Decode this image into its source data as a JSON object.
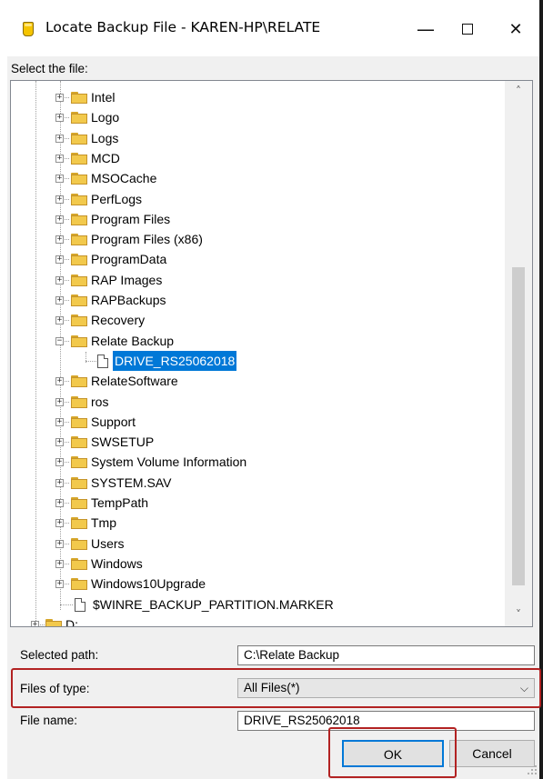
{
  "window": {
    "title": "Locate Backup File - KAREN-HP\\RELATE",
    "minimize_label": "—",
    "close_label": "✕"
  },
  "select_label": "Select the file:",
  "tree": {
    "items": [
      {
        "label": "Intel",
        "type": "folder",
        "expander": "+"
      },
      {
        "label": "Logo",
        "type": "folder",
        "expander": "+"
      },
      {
        "label": "Logs",
        "type": "folder",
        "expander": "+"
      },
      {
        "label": "MCD",
        "type": "folder",
        "expander": "+"
      },
      {
        "label": "MSOCache",
        "type": "folder",
        "expander": "+"
      },
      {
        "label": "PerfLogs",
        "type": "folder",
        "expander": "+"
      },
      {
        "label": "Program Files",
        "type": "folder",
        "expander": "+"
      },
      {
        "label": "Program Files (x86)",
        "type": "folder",
        "expander": "+"
      },
      {
        "label": "ProgramData",
        "type": "folder",
        "expander": "+"
      },
      {
        "label": "RAP Images",
        "type": "folder",
        "expander": "+"
      },
      {
        "label": "RAPBackups",
        "type": "folder",
        "expander": "+"
      },
      {
        "label": "Recovery",
        "type": "folder",
        "expander": "+"
      },
      {
        "label": "Relate Backup",
        "type": "folder",
        "expander": "−"
      },
      {
        "label": "DRIVE_RS25062018",
        "type": "file",
        "selected": true
      },
      {
        "label": "RelateSoftware",
        "type": "folder",
        "expander": "+"
      },
      {
        "label": "ros",
        "type": "folder",
        "expander": "+"
      },
      {
        "label": "Support",
        "type": "folder",
        "expander": "+"
      },
      {
        "label": "SWSETUP",
        "type": "folder",
        "expander": "+"
      },
      {
        "label": "System Volume Information",
        "type": "folder",
        "expander": "+"
      },
      {
        "label": "SYSTEM.SAV",
        "type": "folder",
        "expander": "+"
      },
      {
        "label": "TempPath",
        "type": "folder",
        "expander": "+"
      },
      {
        "label": "Tmp",
        "type": "folder",
        "expander": "+"
      },
      {
        "label": "Users",
        "type": "folder",
        "expander": "+"
      },
      {
        "label": "Windows",
        "type": "folder",
        "expander": "+"
      },
      {
        "label": "Windows10Upgrade",
        "type": "folder",
        "expander": "+"
      },
      {
        "label": "$WINRE_BACKUP_PARTITION.MARKER",
        "type": "rootfile"
      },
      {
        "label": "D:",
        "type": "drive",
        "expander": "+"
      }
    ]
  },
  "scrollbar": {
    "up_icon": "˄",
    "down_icon": "˅"
  },
  "fields": {
    "selected_path_label": "Selected path:",
    "selected_path_value": "C:\\Relate Backup",
    "files_of_type_label": "Files of type:",
    "files_of_type_value": "All Files(*)",
    "file_name_label": "File name:",
    "file_name_value": "DRIVE_RS25062018"
  },
  "buttons": {
    "ok": "OK",
    "cancel": "Cancel"
  },
  "colors": {
    "selection": "#0078d7",
    "highlight": "#b22222"
  }
}
